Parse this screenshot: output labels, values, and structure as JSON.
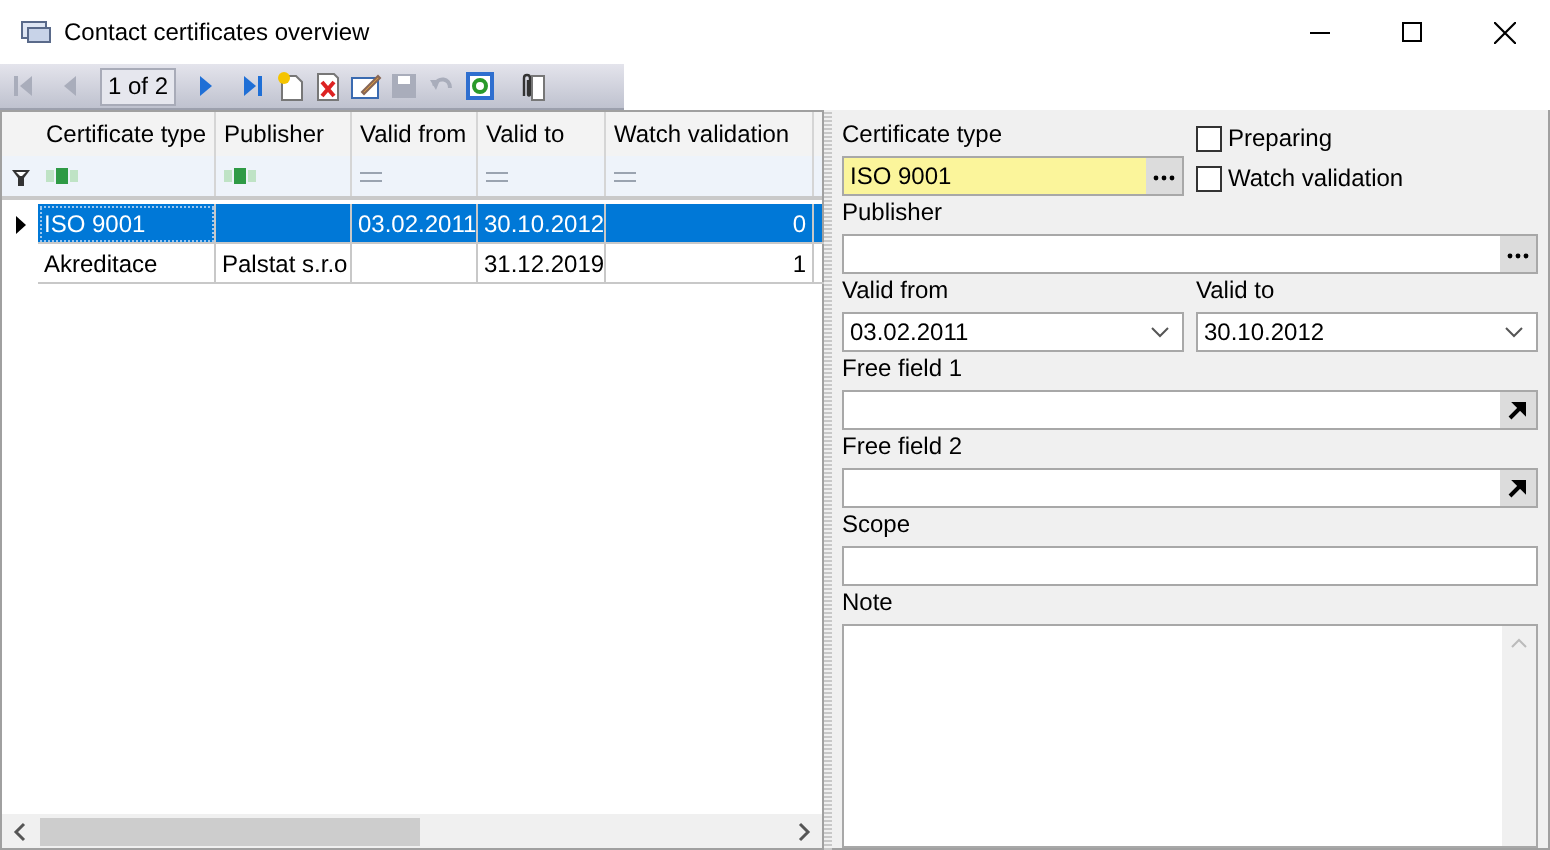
{
  "window": {
    "title": "Contact certificates overview"
  },
  "toolbar": [
    {
      "kind": "first",
      "disabled": true
    },
    {
      "kind": "prev",
      "disabled": true
    },
    {
      "kind": "counter",
      "label": "1 of 2"
    },
    {
      "kind": "next",
      "disabled": false
    },
    {
      "kind": "last",
      "disabled": false
    },
    {
      "kind": "new",
      "disabled": false
    },
    {
      "kind": "delete",
      "disabled": false
    },
    {
      "kind": "edit",
      "disabled": false
    },
    {
      "kind": "save",
      "disabled": true
    },
    {
      "kind": "undo",
      "disabled": true
    },
    {
      "kind": "refresh",
      "disabled": false
    },
    {
      "kind": "attach",
      "disabled": false
    }
  ],
  "grid": {
    "columns": [
      {
        "label": "Certificate type",
        "kind": "text"
      },
      {
        "label": "Publisher",
        "kind": "text"
      },
      {
        "label": "Valid from",
        "kind": "date"
      },
      {
        "label": "Valid to",
        "kind": "date"
      },
      {
        "label": "Watch validation",
        "kind": "number"
      }
    ],
    "rows": [
      {
        "selected": true,
        "cells": [
          "ISO 9001",
          "",
          "03.02.2011",
          "30.10.2012",
          "0"
        ]
      },
      {
        "selected": false,
        "cells": [
          "Akreditace",
          "Palstat s.r.o",
          "",
          "31.12.2019",
          "1"
        ]
      }
    ]
  },
  "form": {
    "certificate_type": {
      "label": "Certificate type",
      "value": "ISO 9001"
    },
    "checkboxes": [
      {
        "label": "Preparing",
        "checked": false
      },
      {
        "label": "Watch validation",
        "checked": false
      }
    ],
    "publisher": {
      "label": "Publisher"
    },
    "valid_from": {
      "label": "Valid from",
      "value": "03.02.2011"
    },
    "valid_to": {
      "label": "Valid to",
      "value": "30.10.2012"
    },
    "free_field_1": {
      "label": "Free field 1"
    },
    "free_field_2": {
      "label": "Free field 2"
    },
    "scope": {
      "label": "Scope"
    },
    "note": {
      "label": "Note"
    }
  }
}
